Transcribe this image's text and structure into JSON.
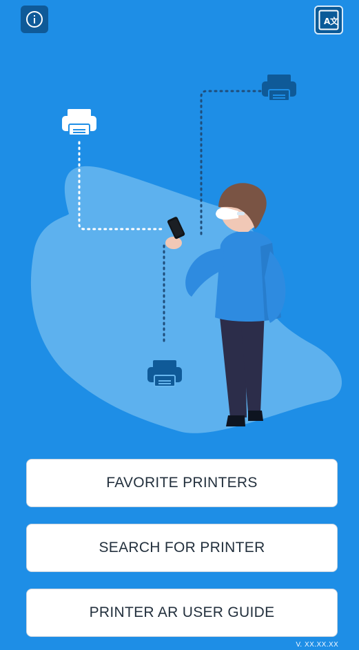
{
  "top_bar": {
    "info_icon": "info-icon",
    "translate_icon": "translate-icon"
  },
  "illustration": {
    "printers": [
      {
        "icon": "printer-icon",
        "color": "#ffffff"
      },
      {
        "icon": "printer-icon",
        "color": "#0f5a98"
      },
      {
        "icon": "printer-icon",
        "color": "#0f5a98"
      }
    ],
    "person": "person-holding-phone",
    "phone_icon": "smartphone-icon"
  },
  "actions": {
    "favorite_printers": "FAVORITE PRINTERS",
    "search_for_printer": "SEARCH FOR PRINTER",
    "printer_ar_user_guide": "PRINTER AR USER GUIDE"
  },
  "footer": {
    "version": "V. XX.XX.XX"
  },
  "colors": {
    "background": "#1e8ee6",
    "dark_blue": "#0f5a98",
    "button_text": "#23303d"
  }
}
